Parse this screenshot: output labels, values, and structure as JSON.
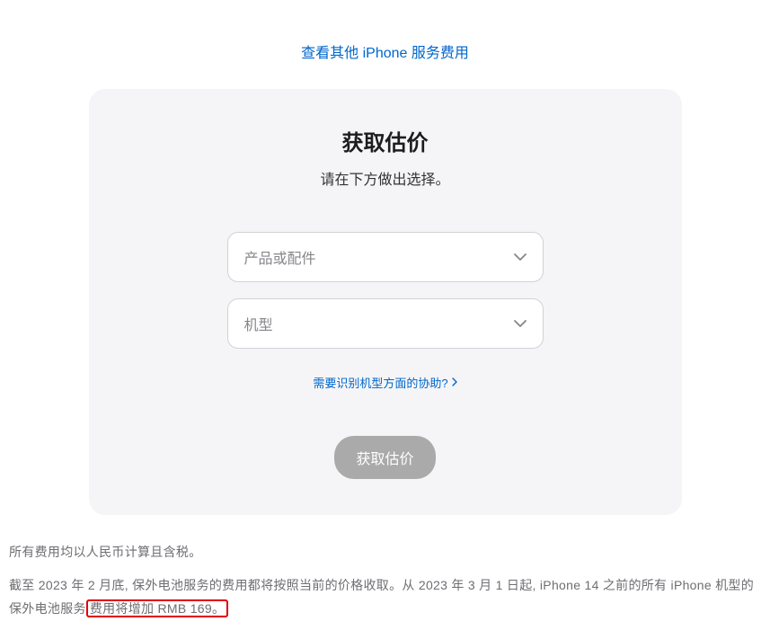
{
  "topLink": "查看其他 iPhone 服务费用",
  "card": {
    "title": "获取估价",
    "subtitle": "请在下方做出选择。",
    "select1Placeholder": "产品或配件",
    "select2Placeholder": "机型",
    "helpLink": "需要识别机型方面的协助?",
    "button": "获取估价"
  },
  "footer": {
    "line1": "所有费用均以人民币计算且含税。",
    "line2Part1": "截至 2023 年 2 月底, 保外电池服务的费用都将按照当前的价格收取。从 2023 年 3 月 1 日起, iPhone 14 之前的所有 iPhone 机型的保外电池服务",
    "line2Highlight": "费用将增加 RMB 169。"
  }
}
